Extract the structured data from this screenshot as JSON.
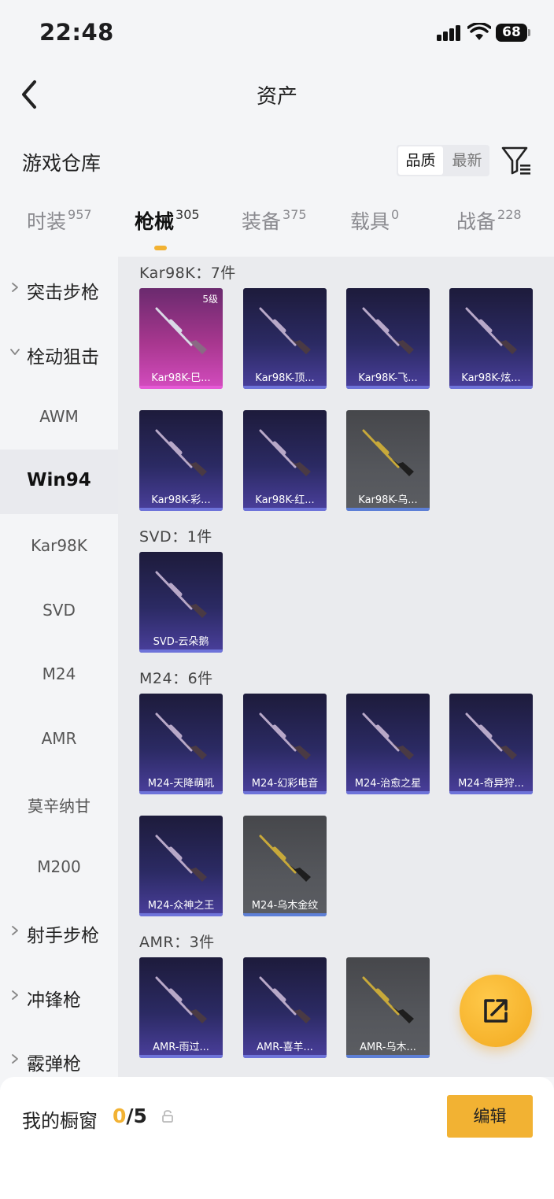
{
  "status_bar": {
    "time": "22:48",
    "battery": "68"
  },
  "nav": {
    "title": "资产"
  },
  "header": {
    "title": "游戏仓库",
    "sort_options": [
      "品质",
      "最新"
    ],
    "sort_selected": "品质"
  },
  "tabs": [
    {
      "label": "时装",
      "count": "957"
    },
    {
      "label": "枪械",
      "count": "305",
      "active": true
    },
    {
      "label": "装备",
      "count": "375"
    },
    {
      "label": "载具",
      "count": "0"
    },
    {
      "label": "战备",
      "count": "228"
    }
  ],
  "sidebar": [
    {
      "label": "突击步枪",
      "kind": "category",
      "expanded": false
    },
    {
      "label": "栓动狙击",
      "kind": "category",
      "expanded": true
    },
    {
      "label": "AWM",
      "kind": "sub"
    },
    {
      "label": "Win94",
      "kind": "sub",
      "selected": true
    },
    {
      "label": "Kar98K",
      "kind": "sub"
    },
    {
      "label": "SVD",
      "kind": "sub"
    },
    {
      "label": "M24",
      "kind": "sub"
    },
    {
      "label": "AMR",
      "kind": "sub"
    },
    {
      "label": "莫辛纳甘",
      "kind": "sub"
    },
    {
      "label": "M200",
      "kind": "sub"
    },
    {
      "label": "射手步枪",
      "kind": "category",
      "expanded": false
    },
    {
      "label": "冲锋枪",
      "kind": "category",
      "expanded": false
    },
    {
      "label": "霰弹枪",
      "kind": "category",
      "expanded": false
    }
  ],
  "groups": [
    {
      "title": "Kar98K：7件",
      "items": [
        {
          "name": "Kar98K-巳...",
          "level": "5级",
          "rarity": "pink"
        },
        {
          "name": "Kar98K-顶...",
          "rarity": "purple"
        },
        {
          "name": "Kar98K-飞...",
          "rarity": "purple"
        },
        {
          "name": "Kar98K-炫...",
          "rarity": "purple"
        },
        {
          "name": "Kar98K-彩...",
          "rarity": "purple"
        },
        {
          "name": "Kar98K-红...",
          "rarity": "purple"
        },
        {
          "name": "Kar98K-乌...",
          "rarity": "grey"
        }
      ]
    },
    {
      "title": "SVD：1件",
      "items": [
        {
          "name": "SVD-云朵鹅",
          "rarity": "purple"
        }
      ]
    },
    {
      "title": "M24：6件",
      "items": [
        {
          "name": "M24-天降萌吼",
          "rarity": "purple"
        },
        {
          "name": "M24-幻彩电音",
          "rarity": "purple"
        },
        {
          "name": "M24-治愈之星",
          "rarity": "purple"
        },
        {
          "name": "M24-奇异狩...",
          "rarity": "purple"
        },
        {
          "name": "M24-众神之王",
          "rarity": "purple"
        },
        {
          "name": "M24-乌木金纹",
          "rarity": "grey"
        }
      ]
    },
    {
      "title": "AMR：3件",
      "items": [
        {
          "name": "AMR-雨过...",
          "rarity": "purple"
        },
        {
          "name": "AMR-喜羊...",
          "rarity": "purple"
        },
        {
          "name": "AMR-乌木...",
          "rarity": "grey"
        }
      ]
    }
  ],
  "bottom": {
    "showcase_label": "我的橱窗",
    "count_current": "0",
    "count_max": "/5",
    "edit_label": "编辑"
  },
  "colors": {
    "accent": "#f2b233",
    "card_purple": "#2b2a63",
    "card_pink": "#d44cbf",
    "card_grey": "#55575c"
  },
  "icons": {
    "back": "chevron-left-icon",
    "filter": "filter-icon",
    "share": "share-icon",
    "lock": "lock-icon"
  }
}
